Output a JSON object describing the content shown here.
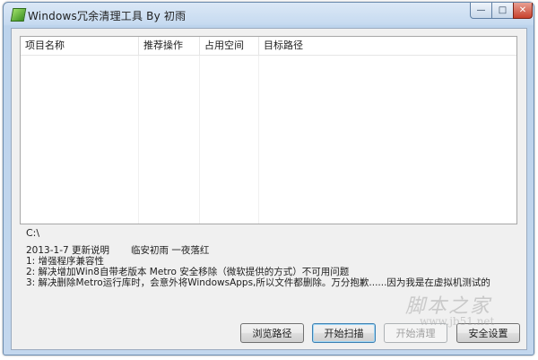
{
  "window": {
    "title": "Windows冗余清理工具 By 初雨",
    "controls": {
      "minimize": "—",
      "maximize": "□",
      "close": "✕"
    }
  },
  "listview": {
    "columns": [
      "项目名称",
      "推荐操作",
      "占用空间",
      "目标路径"
    ],
    "rows": []
  },
  "path": "C:\\",
  "notes": {
    "header_date": "2013-1-7 更新说明",
    "header_author": "临安初雨 一夜落红",
    "lines": [
      "1: 增强程序兼容性",
      "2: 解决增加Win8自带老版本 Metro 安全移除（微软提供的方式）不可用问题",
      "3: 解决删除Metro运行库时，会意外将WindowsApps,所以文件都删除。万分抱歉......因为我是在虚拟机测试的"
    ]
  },
  "buttons": {
    "browse": "浏览路径",
    "scan": "开始扫描",
    "clean": "开始清理",
    "settings": "安全设置"
  },
  "watermark": {
    "brand": "脚本之家",
    "url": "www.jb51.net"
  },
  "colors": {
    "title_bar": "#c6daf0",
    "client_bg": "#f0f0f0",
    "default_button_border": "#3c7fb1"
  }
}
